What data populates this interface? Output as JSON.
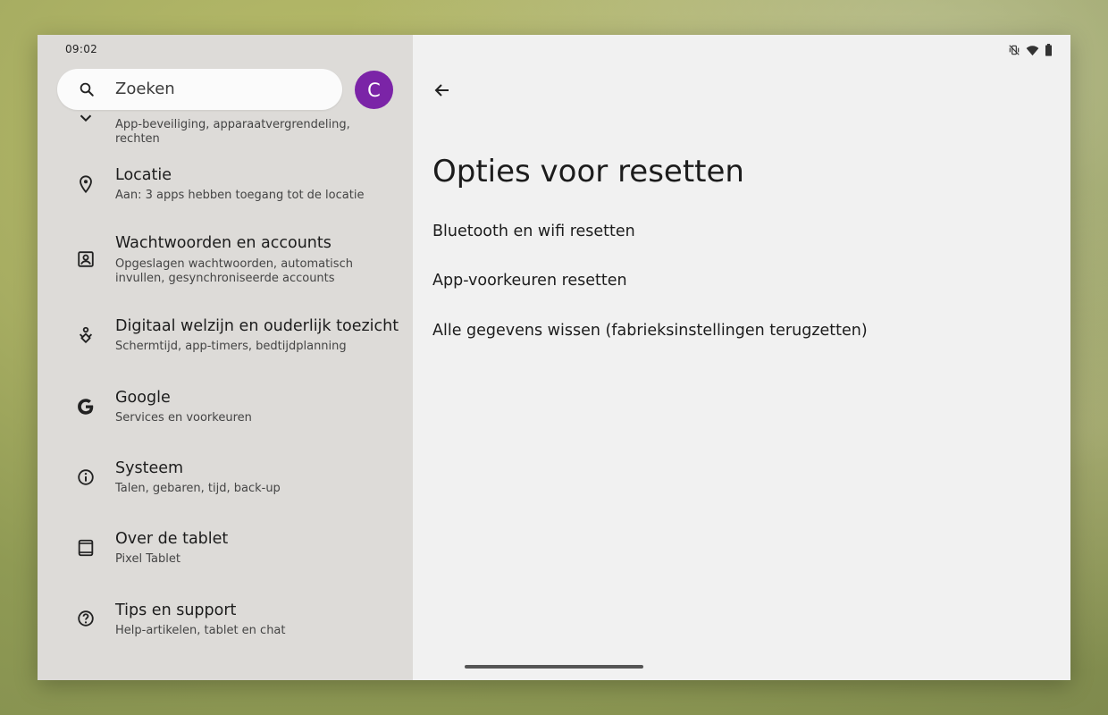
{
  "status_bar": {
    "time": "09:02"
  },
  "search": {
    "placeholder": "Zoeken"
  },
  "avatar": {
    "initial": "C",
    "color": "#7b24a7"
  },
  "sidebar": {
    "items": [
      {
        "title": "",
        "subtitle": "App-beveiliging, apparaatvergrendeling, rechten",
        "icon": "chevron-down-icon"
      },
      {
        "title": "Locatie",
        "subtitle": "Aan: 3 apps hebben toegang tot de locatie",
        "icon": "location-pin-icon"
      },
      {
        "title": "Wachtwoorden en accounts",
        "subtitle": "Opgeslagen wachtwoorden, automatisch invullen, gesynchroniseerde accounts",
        "icon": "account-box-icon"
      },
      {
        "title": "Digitaal welzijn en ouderlijk toezicht",
        "subtitle": "Schermtijd, app-timers, bedtijdplanning",
        "icon": "wellbeing-icon"
      },
      {
        "title": "Google",
        "subtitle": "Services en voorkeuren",
        "icon": "google-icon"
      },
      {
        "title": "Systeem",
        "subtitle": "Talen, gebaren, tijd, back-up",
        "icon": "info-icon"
      },
      {
        "title": "Over de tablet",
        "subtitle": "Pixel Tablet",
        "icon": "tablet-icon"
      },
      {
        "title": "Tips en support",
        "subtitle": "Help-artikelen, tablet en chat",
        "icon": "help-icon"
      }
    ]
  },
  "main": {
    "title": "Opties voor resetten",
    "options": [
      "Bluetooth en wifi resetten",
      "App-voorkeuren resetten",
      "Alle gegevens wissen (fabrieksinstellingen terugzetten)"
    ]
  },
  "colors": {
    "sidebar_bg": "#dddbd8",
    "content_bg": "#f1f1f1",
    "accent": "#7b24a7"
  }
}
